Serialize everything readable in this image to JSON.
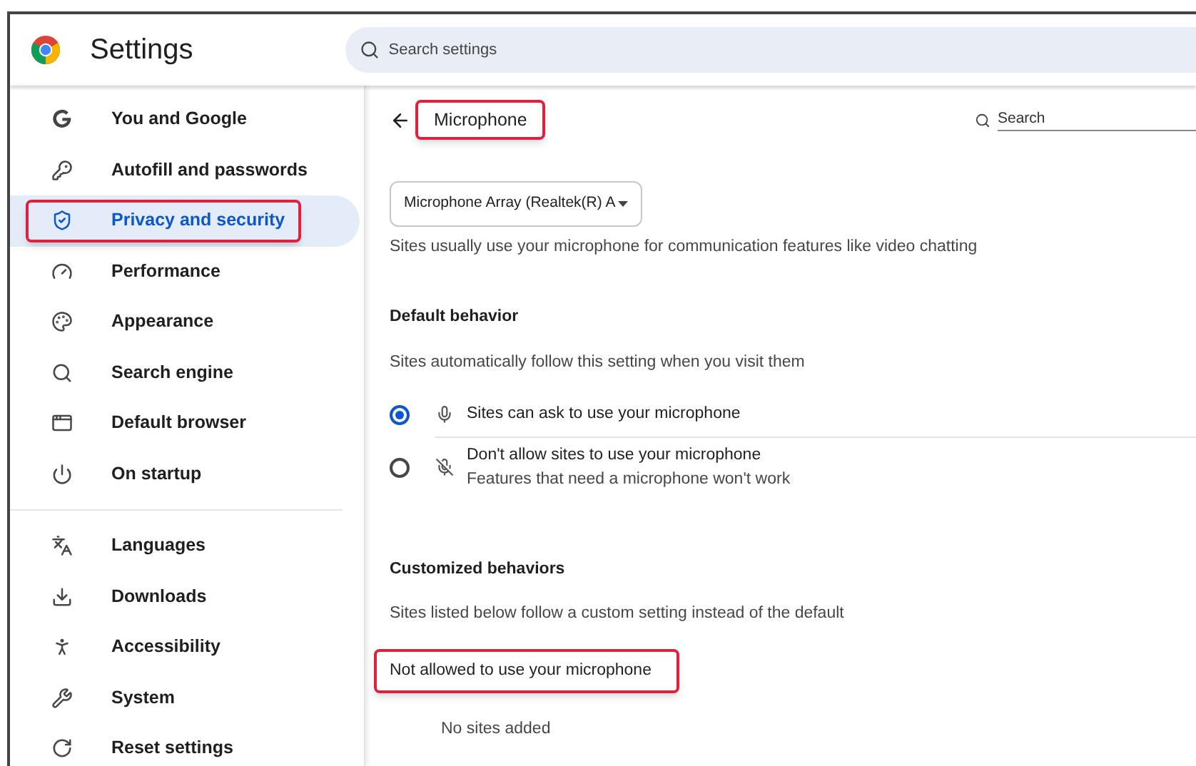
{
  "header": {
    "title": "Settings",
    "search": {
      "placeholder": "Search settings"
    }
  },
  "sidebar": {
    "groups": [
      [
        {
          "label": "You and Google",
          "kind": "google",
          "selected": false,
          "highlighted": false
        },
        {
          "label": "Autofill and passwords",
          "kind": "key",
          "selected": false,
          "highlighted": false
        },
        {
          "label": "Privacy and security",
          "kind": "shield",
          "selected": true,
          "highlighted": true
        },
        {
          "label": "Performance",
          "kind": "gauge",
          "selected": false,
          "highlighted": false
        },
        {
          "label": "Appearance",
          "kind": "palette",
          "selected": false,
          "highlighted": false
        },
        {
          "label": "Search engine",
          "kind": "search",
          "selected": false,
          "highlighted": false
        },
        {
          "label": "Default browser",
          "kind": "browser",
          "selected": false,
          "highlighted": false
        },
        {
          "label": "On startup",
          "kind": "power",
          "selected": false,
          "highlighted": false
        }
      ],
      [
        {
          "label": "Languages",
          "kind": "languages",
          "selected": false,
          "highlighted": false
        },
        {
          "label": "Downloads",
          "kind": "download",
          "selected": false,
          "highlighted": false
        },
        {
          "label": "Accessibility",
          "kind": "accessibility",
          "selected": false,
          "highlighted": false
        },
        {
          "label": "System",
          "kind": "wrench",
          "selected": false,
          "highlighted": false
        },
        {
          "label": "Reset settings",
          "kind": "reset",
          "selected": false,
          "highlighted": false
        }
      ]
    ]
  },
  "page": {
    "title": "Microphone",
    "title_highlighted": true,
    "search": {
      "placeholder": "Search"
    },
    "device_select": {
      "value": "Microphone Array (Realtek(R) A"
    },
    "description": "Sites usually use your microphone for communication features like video chatting",
    "default_behavior": {
      "heading": "Default behavior",
      "description": "Sites automatically follow this setting when you visit them",
      "options": [
        {
          "kind": "allow",
          "label": "Sites can ask to use your microphone",
          "selected": true
        },
        {
          "kind": "block",
          "label": "Don't allow sites to use your microphone",
          "sublabel": "Features that need a microphone won't work",
          "selected": false
        }
      ]
    },
    "customized": {
      "heading": "Customized behaviors",
      "description": "Sites listed below follow a custom setting instead of the default",
      "lists": [
        {
          "heading": "Not allowed to use your microphone",
          "highlighted": true,
          "empty_text": "No sites added"
        }
      ]
    }
  }
}
